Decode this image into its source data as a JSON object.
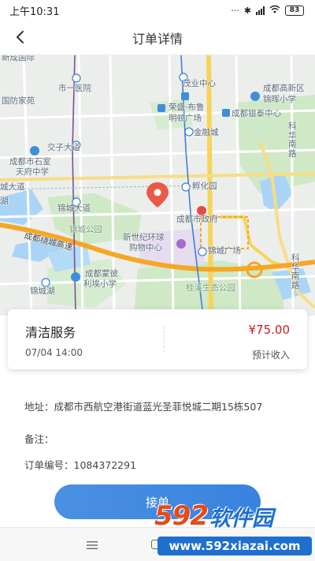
{
  "status_bar": {
    "time": "上午10:31",
    "battery": "83"
  },
  "nav": {
    "title": "订单详情"
  },
  "map": {
    "labels": {
      "xincheng": "新成国际",
      "shi_yiyuan": "市一医院",
      "maoye": "茂业中心",
      "gaoxin": "成都高新区",
      "jinhui": "锦晖小学",
      "guofang": "国防家苑",
      "rongsheng_top": "荣盛·布鲁",
      "rongsheng_bottom": "明顿广场",
      "yintai": "成都银泰中心",
      "jinrongcheng": "金融城",
      "jiaozi": "交子大道",
      "keji": "科华南路",
      "shishi_line1": "成都市石室",
      "shishi_line2": "天府中学",
      "fuhua": "孵化园",
      "chengdu_gov": "成都市政府",
      "jincheng_road": "锦城大道",
      "jincheng_park": "锦城公园",
      "huancheng": "成都绕城高速",
      "new_century_line1": "新世纪环球",
      "new_century_line2": "购物中心",
      "jincheng_plaza": "锦城广场",
      "kehua_south": "科华南路",
      "mengbi_line1": "成都蒙彼",
      "mengbi_line2": "利埃小学",
      "jincheng_lake": "锦城湖",
      "guixi": "桂溪生态公园",
      "lake_left": "湖",
      "city_road": "城大道"
    }
  },
  "order": {
    "service_name": "清洁服务",
    "time": "07/04 14:00",
    "price": "¥75.00",
    "income_label": "预计收入"
  },
  "details": {
    "address_label": "地址：",
    "address_value": "成都市西航空港街道蓝光圣菲悦城二期15栋507",
    "note_label": "备注：",
    "note_value": "",
    "order_no_label": "订单编号：",
    "order_no_value": "1084372291"
  },
  "actions": {
    "accept": "接单"
  },
  "watermark": {
    "num": "592",
    "text": "软件园",
    "url": "www.592xiazai.com"
  },
  "colors": {
    "accent": "#4a90e2",
    "price": "#d01c1c",
    "map_road_orange": "#f5a623",
    "map_road_yellow": "#f8d35a",
    "map_park": "#cfe8c6",
    "map_water": "#a9d4f5",
    "map_pin": "#ea5a47"
  }
}
